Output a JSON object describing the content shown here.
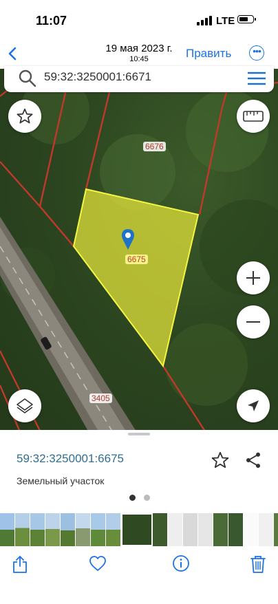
{
  "status_bar": {
    "time": "11:07",
    "network": "LTE"
  },
  "nav": {
    "date": "19 мая 2023 г.",
    "time": "10:45",
    "edit_label": "Править"
  },
  "search": {
    "query": "59:32:3250001:6671"
  },
  "map": {
    "parcels": {
      "selected": "6675",
      "neighbor": "6676",
      "road": "3405"
    },
    "colors": {
      "selected_fill": "#e8e83a",
      "boundary": "#c0392b",
      "pin": "#1e73c8"
    }
  },
  "details": {
    "cadastral_number": "59:32:3250001:6675",
    "type": "Земельный участок",
    "accent": "#2f6f8f"
  },
  "pager": {
    "pages": 2,
    "active": 1
  },
  "toolbar": {
    "icons": [
      "share-icon",
      "heart-icon",
      "info-icon",
      "trash-icon"
    ],
    "accent": "#1a73e8"
  }
}
